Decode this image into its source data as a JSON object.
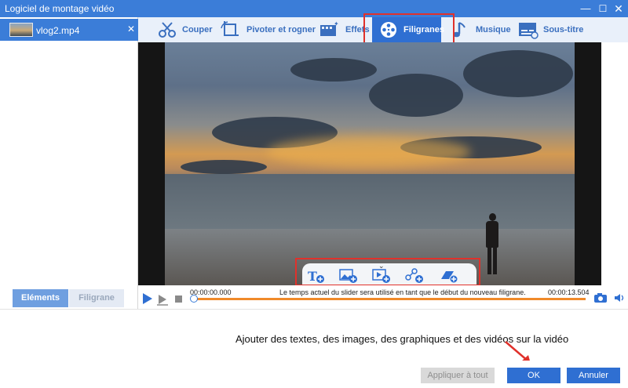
{
  "window": {
    "title": "Logiciel de montage vidéo",
    "controls": [
      "minimize",
      "maximize",
      "close"
    ]
  },
  "file_list": {
    "items": [
      {
        "name": "vlog2.mp4",
        "selected": true
      }
    ]
  },
  "left_tabs": [
    {
      "label": "Eléments",
      "active": true
    },
    {
      "label": "Filigrane",
      "active": false
    }
  ],
  "toolbar": {
    "tools": [
      {
        "label": "Couper",
        "icon": "cut-icon",
        "active": false
      },
      {
        "label": "Pivoter et rogner",
        "icon": "rotate-crop-icon",
        "active": false
      },
      {
        "label": "Effets",
        "icon": "effects-icon",
        "active": false
      },
      {
        "label": "Filigranes",
        "icon": "watermark-reel-icon",
        "active": true
      },
      {
        "label": "Musique",
        "icon": "music-note-icon",
        "active": false
      },
      {
        "label": "Sous-titre",
        "icon": "subtitle-icon",
        "active": false
      }
    ]
  },
  "watermark_tray": {
    "items": [
      {
        "icon": "add-text-icon"
      },
      {
        "icon": "add-image-icon"
      },
      {
        "icon": "add-video-icon"
      },
      {
        "icon": "add-graphic-icon"
      },
      {
        "icon": "add-shape-icon"
      }
    ]
  },
  "timeline": {
    "current_time": "00:00:00.000",
    "note": "Le temps actuel du slider sera utilisé en tant que le début du nouveau filigrane.",
    "total_time": "00:00:13.504",
    "position_fraction": 0
  },
  "annotation": {
    "text": "Ajouter des textes, des images, des graphiques et des vidéos sur la vidéo"
  },
  "buttons": {
    "apply_all": "Appliquer à tout",
    "ok": "OK",
    "cancel": "Annuler"
  },
  "colors": {
    "accent": "#2f6fd2",
    "highlight_box": "#e0312b",
    "timeline_track": "#f08a2a"
  }
}
